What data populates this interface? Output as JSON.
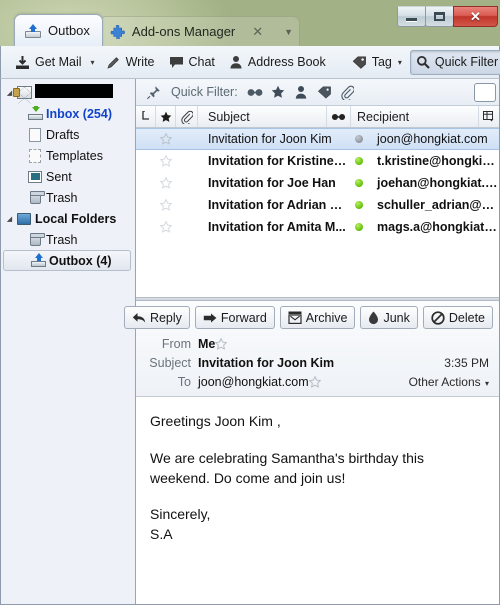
{
  "window": {
    "controls": {
      "minimize": "–",
      "maximize": "□",
      "close": "✕"
    }
  },
  "tabs": [
    {
      "label": "Outbox",
      "icon": "outbox-icon",
      "active": true
    },
    {
      "label": "Add-ons Manager",
      "icon": "puzzle-icon",
      "active": false,
      "close": "✕",
      "chevron": "▼"
    }
  ],
  "toolbar": {
    "get_mail": "Get Mail",
    "get_mail_caret": "▾",
    "write": "Write",
    "chat": "Chat",
    "address_book": "Address Book",
    "tag": "Tag",
    "tag_caret": "▾",
    "quick_filter": "Quick Filter"
  },
  "sidebar": {
    "items": [
      {
        "label": "",
        "icon": "account-envelope-icon",
        "redacted": true,
        "twisty": "◢",
        "level": 0
      },
      {
        "label": "Inbox (254)",
        "icon": "inbox-icon",
        "unread": true,
        "level": 1
      },
      {
        "label": "Drafts",
        "icon": "drafts-icon",
        "level": 1
      },
      {
        "label": "Templates",
        "icon": "templates-icon",
        "level": 1
      },
      {
        "label": "Sent",
        "icon": "sent-icon",
        "level": 1
      },
      {
        "label": "Trash",
        "icon": "trash-icon",
        "level": 1
      },
      {
        "label": "Local Folders",
        "icon": "local-folders-icon",
        "bold": true,
        "twisty": "◢",
        "level": 0
      },
      {
        "label": "Trash",
        "icon": "trash-icon",
        "level": 1
      },
      {
        "label": "Outbox (4)",
        "icon": "outbox-folder-icon",
        "selected": true,
        "level": 1
      }
    ]
  },
  "quick_filter_bar": {
    "label": "Quick Filter:",
    "pin_icon": "pin-icon",
    "filters": [
      "unread-icon",
      "starred-icon",
      "contact-icon",
      "tag-icon",
      "attachment-icon"
    ],
    "search_placeholder": ""
  },
  "message_list": {
    "columns": {
      "thread": "thread-column-icon",
      "star": "star-column-icon",
      "attachment": "attachment-column-icon",
      "subject": "Subject",
      "unread": "unread-column-icon",
      "recipient": "Recipient",
      "picker": "column-picker-icon"
    },
    "rows": [
      {
        "subject": "Invitation for Joon Kim",
        "recipient": "joon@hongkiat.com",
        "status": "read",
        "selected": true
      },
      {
        "subject": "Invitation for Kristine ...",
        "recipient": "t.kristine@hongkiat....",
        "status": "unread",
        "selected": false
      },
      {
        "subject": "Invitation for Joe Han",
        "recipient": "joehan@hongkiat.com",
        "status": "unread",
        "selected": false
      },
      {
        "subject": "Invitation for Adrian S...",
        "recipient": "schuller_adrian@hon...",
        "status": "unread",
        "selected": false
      },
      {
        "subject": "Invitation for Amita M...",
        "recipient": "mags.a@hongkiat.com",
        "status": "unread",
        "selected": false
      }
    ]
  },
  "message_header": {
    "actions": [
      {
        "label": "Reply",
        "icon": "reply-arrow-icon"
      },
      {
        "label": "Forward",
        "icon": "forward-arrow-icon"
      },
      {
        "label": "Archive",
        "icon": "archive-box-icon"
      },
      {
        "label": "Junk",
        "icon": "junk-flame-icon"
      },
      {
        "label": "Delete",
        "icon": "delete-ban-icon"
      }
    ],
    "from_key": "From",
    "from_value": "Me",
    "subject_key": "Subject",
    "subject_value": "Invitation for Joon Kim",
    "time": "3:35 PM",
    "to_key": "To",
    "to_value": "joon@hongkiat.com",
    "other_actions": "Other Actions",
    "other_actions_caret": "▾"
  },
  "message_body": {
    "greeting": "Greetings Joon Kim ,",
    "paragraph": "We are celebrating Samantha's birthday this weekend. Do come and join us!",
    "closing": "Sincerely,",
    "signature": "S.A"
  },
  "colors": {
    "unread_dot": "#63bf07",
    "read_dot": "#8f979f",
    "unread_folder_text": "#1144cc",
    "selection": "#cfe0f5",
    "close_button": "#bf342a"
  }
}
